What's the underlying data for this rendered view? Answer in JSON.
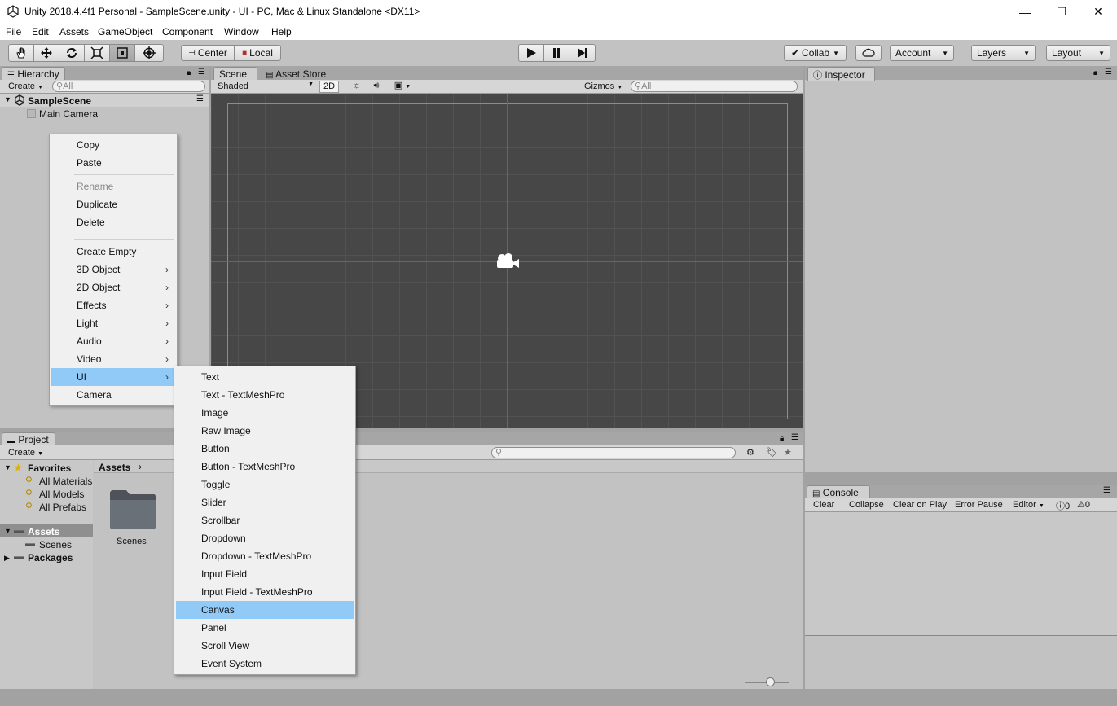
{
  "window": {
    "title": "Unity 2018.4.4f1 Personal - SampleScene.unity - UI - PC, Mac & Linux Standalone <DX11>",
    "minimize": "—",
    "maximize": "☐",
    "close": "✕"
  },
  "menubar": [
    "File",
    "Edit",
    "Assets",
    "GameObject",
    "Component",
    "Window",
    "Help"
  ],
  "toolbar": {
    "pivot": "Center",
    "space": "Local",
    "collab": "Collab",
    "account": "Account",
    "layers": "Layers",
    "layout": "Layout"
  },
  "hierarchy": {
    "tab": "Hierarchy",
    "create": "Create",
    "search_placeholder": "All",
    "scene": "SampleScene",
    "items": [
      "Main Camera"
    ]
  },
  "scene": {
    "tabs": [
      "Scene",
      "Asset Store"
    ],
    "shading": "Shaded",
    "mode_2d": "2D",
    "gizmos": "Gizmos",
    "search_placeholder": "All"
  },
  "inspector": {
    "tab": "Inspector"
  },
  "project": {
    "tab": "Project",
    "create": "Create",
    "favorites": "Favorites",
    "favorite_items": [
      "All Materials",
      "All Models",
      "All Prefabs"
    ],
    "assets": "Assets",
    "scenes": "Scenes",
    "packages": "Packages",
    "breadcrumb": "Assets",
    "folder": "Scenes"
  },
  "console": {
    "tab": "Console",
    "buttons": [
      "Clear",
      "Collapse",
      "Clear on Play",
      "Error Pause",
      "Editor"
    ],
    "warn_count": "0",
    "info_count": "0"
  },
  "context_menu": {
    "copy": "Copy",
    "paste": "Paste",
    "rename": "Rename",
    "duplicate": "Duplicate",
    "delete": "Delete",
    "create_empty": "Create Empty",
    "submenus": [
      "3D Object",
      "2D Object",
      "Effects",
      "Light",
      "Audio",
      "Video",
      "UI"
    ],
    "camera": "Camera"
  },
  "ui_submenu": [
    "Text",
    "Text - TextMeshPro",
    "Image",
    "Raw Image",
    "Button",
    "Button - TextMeshPro",
    "Toggle",
    "Slider",
    "Scrollbar",
    "Dropdown",
    "Dropdown - TextMeshPro",
    "Input Field",
    "Input Field - TextMeshPro",
    "Canvas",
    "Panel",
    "Scroll View",
    "Event System"
  ],
  "colors": {
    "highlight": "#91c9f7",
    "scene_bg": "#474747",
    "panel_bg": "#c2c2c2"
  }
}
